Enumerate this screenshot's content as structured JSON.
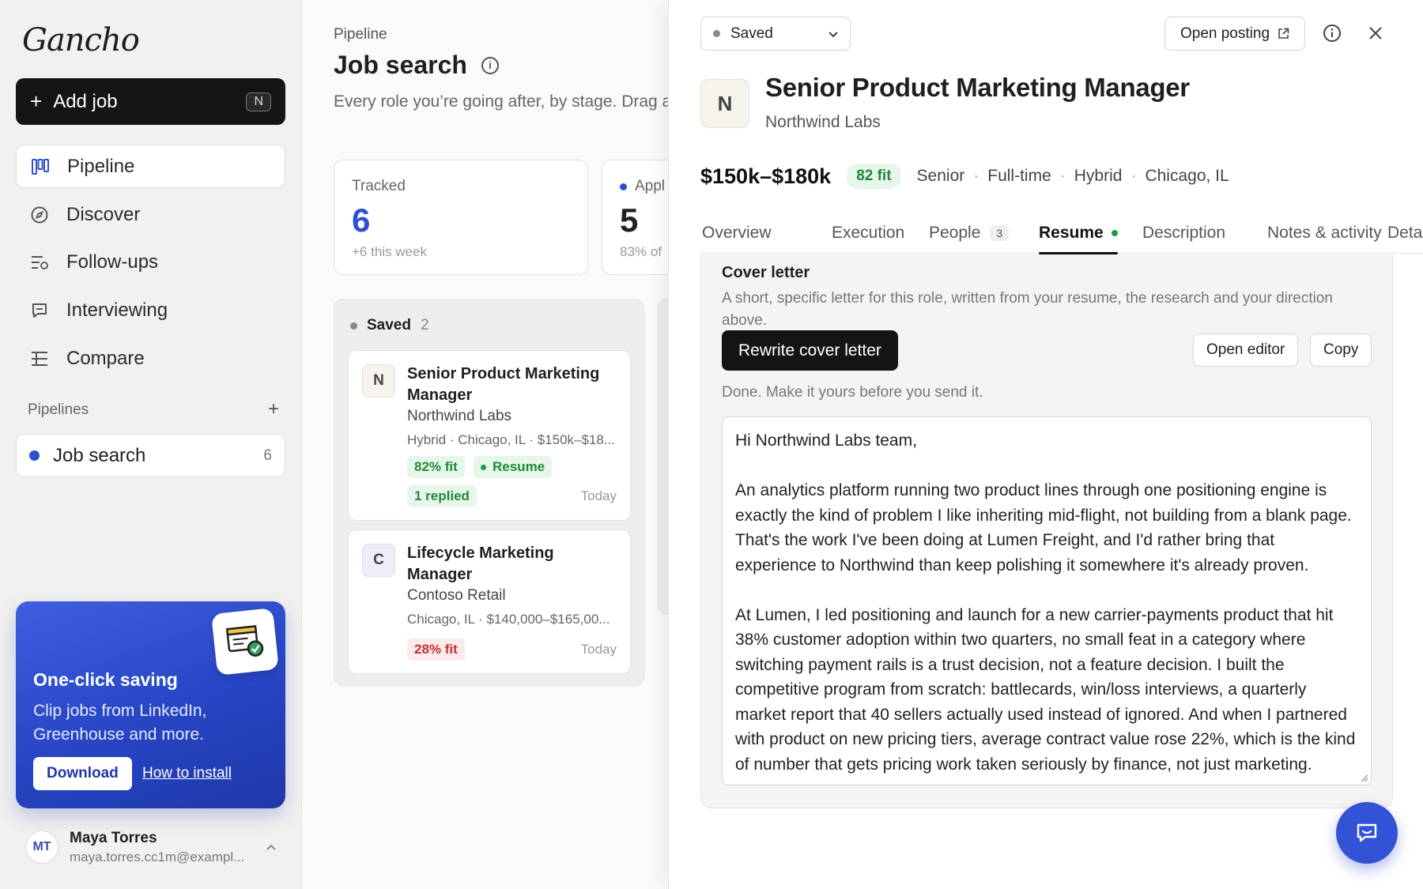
{
  "app": {
    "logo": "Gancho"
  },
  "sidebar": {
    "add_job_label": "Add job",
    "add_job_shortcut": "N",
    "nav": [
      {
        "label": "Pipeline",
        "icon": "pipeline-icon",
        "active": true
      },
      {
        "label": "Discover",
        "icon": "compass-icon"
      },
      {
        "label": "Follow-ups",
        "icon": "follow-ups-icon"
      },
      {
        "label": "Interviewing",
        "icon": "chat-icon"
      },
      {
        "label": "Compare",
        "icon": "compare-icon"
      }
    ],
    "pipelines_heading": "Pipelines",
    "pipeline": {
      "label": "Job search",
      "count": "6",
      "color": "#2f4fd1"
    },
    "promo": {
      "title": "One-click saving",
      "text": "Clip jobs from LinkedIn, Greenhouse and more.",
      "download_label": "Download",
      "howto_label": "How to install"
    },
    "user": {
      "initials": "MT",
      "name": "Maya Torres",
      "email": "maya.torres.cc1m@exampl..."
    }
  },
  "main": {
    "breadcrumb": "Pipeline",
    "title": "Job search",
    "subtitle": "Every role you’re going after, by stage. Drag a",
    "stats": [
      {
        "label": "Tracked",
        "value": "6",
        "sub": "+6 this week"
      },
      {
        "label": "Appl",
        "value": "5",
        "sub": "83% of"
      }
    ],
    "column": {
      "name": "Saved",
      "count": "2",
      "cards": [
        {
          "initial": "N",
          "title": "Senior Product Marketing Manager",
          "company": "Northwind Labs",
          "meta": "Hybrid · Chicago, IL · $150k–$18...",
          "fit": "82% fit",
          "tag": "Resume",
          "extra": "1 replied",
          "when": "Today"
        },
        {
          "initial": "C",
          "title": "Lifecycle Marketing Manager",
          "company": "Contoso Retail",
          "meta": "Chicago, IL · $140,000–$165,00...",
          "fit": "28% fit",
          "when": "Today"
        }
      ]
    }
  },
  "panel": {
    "status": "Saved",
    "open_posting_label": "Open posting",
    "logo_initial": "N",
    "job_title": "Senior Product Marketing Manager",
    "company": "Northwind Labs",
    "salary": "$150k–$180k",
    "fit": "82 fit",
    "meta": [
      "Senior",
      "Full-time",
      "Hybrid",
      "Chicago, IL"
    ],
    "tabs": [
      {
        "label": "Overview"
      },
      {
        "label": "Execution"
      },
      {
        "label": "People",
        "badge": "3"
      },
      {
        "label": "Resume",
        "active": true
      },
      {
        "label": "Description"
      },
      {
        "label": "Notes & activity"
      },
      {
        "label": "Details"
      }
    ],
    "cover_letter": {
      "heading": "Cover letter",
      "description": "A short, specific letter for this role, written from your resume, the research and your direction above.",
      "rewrite_label": "Rewrite cover letter",
      "open_editor_label": "Open editor",
      "copy_label": "Copy",
      "done_text": "Done. Make it yours before you send it.",
      "paragraphs": [
        "Hi Northwind Labs team,",
        "An analytics platform running two product lines through one positioning engine is exactly the kind of problem I like inheriting mid-flight, not building from a blank page. That's the work I've been doing at Lumen Freight, and I'd rather bring that experience to Northwind than keep polishing it somewhere it's already proven.",
        "At Lumen, I led positioning and launch for a new carrier-payments product that hit 38% customer adoption within two quarters, no small feat in a category where switching payment rails is a trust decision, not a feature decision. I built the competitive program from scratch: battlecards, win/loss interviews, a quarterly market report that 40 sellers actually used instead of ignored. And when I partnered with product on new pricing tiers, average contract value rose 22%, which is the kind of number that gets pricing work taken seriously by finance, not just marketing."
      ]
    }
  },
  "colors": {
    "accent": "#2f4fd1",
    "fit_green": "#1f8a3a",
    "fit_red": "#c73030",
    "primary_button": "#141414"
  }
}
